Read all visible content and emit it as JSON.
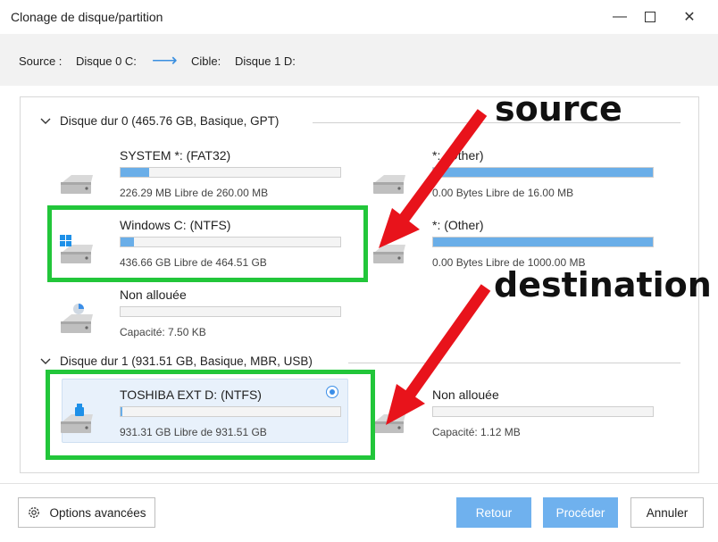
{
  "window": {
    "title": "Clonage de disque/partition",
    "minimize_label": "—",
    "close_label": "✕"
  },
  "pathbar": {
    "source_label": "Source :",
    "source_value": "Disque 0 C:",
    "arrow": "⟶",
    "target_label": "Cible:",
    "target_value": "Disque 1 D:"
  },
  "disks": [
    {
      "header": "Disque dur 0 (465.76 GB, Basique, GPT)",
      "partitions": [
        {
          "name": "SYSTEM *: (FAT32)",
          "info": "226.29 MB Libre de 260.00 MB",
          "used_fraction": 0.13,
          "icon": "drive-icon"
        },
        {
          "name": "*: (Other)",
          "info": "0.00 Bytes Libre de 16.00 MB",
          "used_fraction": 1.0,
          "icon": "drive-icon"
        },
        {
          "name": "Windows C: (NTFS)",
          "info": "436.66 GB Libre de 464.51 GB",
          "used_fraction": 0.06,
          "icon": "windows-drive-icon"
        },
        {
          "name": "*: (Other)",
          "info": "0.00 Bytes Libre de 1000.00 MB",
          "used_fraction": 1.0,
          "icon": "drive-icon"
        },
        {
          "name": "Non allouée",
          "info": "Capacité: 7.50 KB",
          "used_fraction": 0.0,
          "icon": "unallocated-drive-icon"
        }
      ]
    },
    {
      "header": "Disque dur 1 (931.51 GB, Basique, MBR, USB)",
      "partitions": [
        {
          "name": "TOSHIBA EXT D: (NTFS)",
          "info": "931.31 GB Libre de 931.51 GB",
          "used_fraction": 0.01,
          "icon": "usb-drive-icon",
          "selected": true
        },
        {
          "name": "Non allouée",
          "info": "Capacité: 1.12 MB",
          "used_fraction": 0.0,
          "icon": "drive-icon"
        }
      ]
    }
  ],
  "annotations": {
    "source": "source",
    "destination": "destination",
    "highlight_color": "#22c63a",
    "arrow_color": "#e8131b"
  },
  "footer": {
    "options_label": "Options avancées",
    "back_label": "Retour",
    "proceed_label": "Procéder",
    "cancel_label": "Annuler"
  },
  "colors": {
    "accent": "#6fb1ee",
    "bar_fill": "#6aaee8"
  }
}
